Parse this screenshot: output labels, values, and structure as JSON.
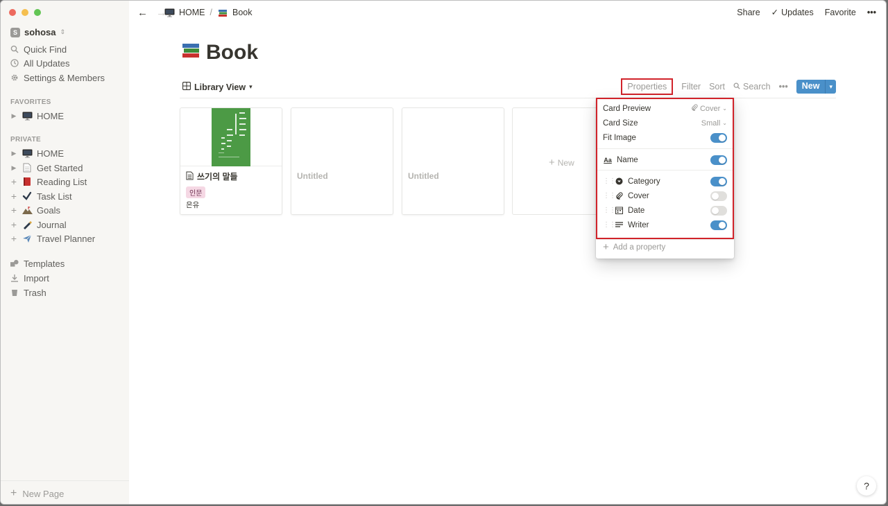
{
  "window": {
    "colors": {
      "close": "#ed6a5e",
      "minimize": "#f5bf4f",
      "zoom": "#62c554"
    }
  },
  "sidebar": {
    "workspace": {
      "badge": "S",
      "name": "sohosa"
    },
    "top_items": [
      {
        "label": "Quick Find",
        "icon": "search-icon"
      },
      {
        "label": "All Updates",
        "icon": "clock-icon"
      },
      {
        "label": "Settings & Members",
        "icon": "gear-icon"
      }
    ],
    "favorites_header": "FAVORITES",
    "favorites": [
      {
        "label": "HOME",
        "icon": "monitor-icon"
      }
    ],
    "private_header": "PRIVATE",
    "private": [
      {
        "label": "HOME",
        "icon": "monitor-icon"
      },
      {
        "label": "Get Started",
        "icon": "page-icon"
      },
      {
        "label": "Reading List",
        "icon": "book-icon"
      },
      {
        "label": "Task List",
        "icon": "checkmark-icon"
      },
      {
        "label": "Goals",
        "icon": "mountain-icon"
      },
      {
        "label": "Journal",
        "icon": "pen-icon"
      },
      {
        "label": "Travel Planner",
        "icon": "airplane-icon"
      }
    ],
    "bottom_items": [
      {
        "label": "Templates",
        "icon": "shapes-icon"
      },
      {
        "label": "Import",
        "icon": "download-icon"
      },
      {
        "label": "Trash",
        "icon": "trash-icon"
      }
    ],
    "new_page": "New Page"
  },
  "topbar": {
    "breadcrumb": [
      {
        "label": "HOME"
      },
      {
        "label": "Book"
      }
    ],
    "separator": "/",
    "share": "Share",
    "updates": "Updates",
    "favorite": "Favorite",
    "more": "•••"
  },
  "page": {
    "title": "Book"
  },
  "view": {
    "name": "Library View",
    "actions": {
      "properties": "Properties",
      "filter": "Filter",
      "sort": "Sort",
      "search": "Search",
      "more": "•••",
      "new": "New"
    }
  },
  "cards": [
    {
      "name": "쓰기의 말들",
      "tag": "인문",
      "writer": "은유",
      "has_cover": true
    },
    {
      "name": "Untitled",
      "has_cover": false
    },
    {
      "name": "Untitled",
      "has_cover": false
    }
  ],
  "new_card": "New",
  "properties_menu": {
    "card_preview": {
      "label": "Card Preview",
      "value": "Cover"
    },
    "card_size": {
      "label": "Card Size",
      "value": "Small"
    },
    "fit_image": {
      "label": "Fit Image",
      "on": true
    },
    "name": {
      "label": "Name",
      "on": true
    },
    "props": [
      {
        "label": "Category",
        "icon": "select-icon",
        "on": true
      },
      {
        "label": "Cover",
        "icon": "paperclip-icon",
        "on": false
      },
      {
        "label": "Date",
        "icon": "calendar-icon",
        "on": false
      },
      {
        "label": "Writer",
        "icon": "text-icon",
        "on": true
      }
    ],
    "add_property": "Add a property"
  },
  "help": "?"
}
